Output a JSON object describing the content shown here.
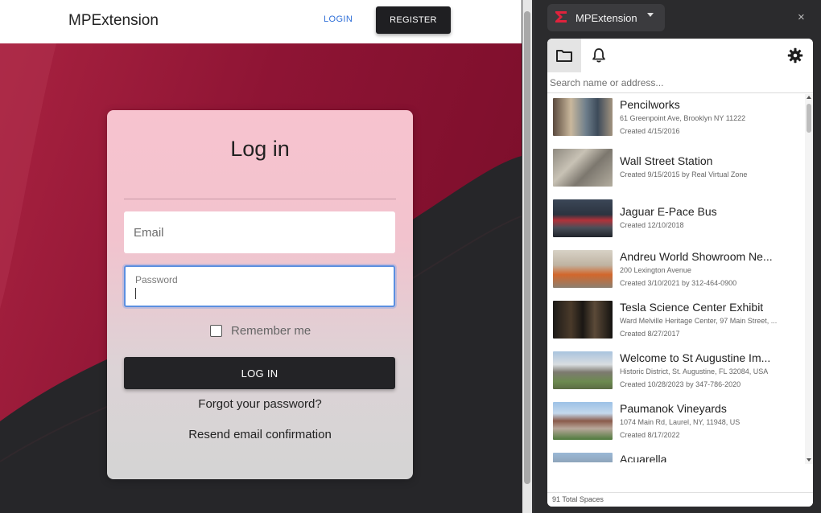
{
  "site": {
    "brand": "MPExtension",
    "nav_login": "LOGIN",
    "nav_register": "REGISTER"
  },
  "login_card": {
    "title": "Log in",
    "email_label": "Email",
    "password_label": "Password",
    "remember_label": "Remember me",
    "remember_checked": false,
    "submit_label": "LOG IN",
    "forgot_label": "Forgot your password?",
    "resend_label": "Resend email confirmation"
  },
  "extension": {
    "name": "MPExtension",
    "close_symbol": "×",
    "search_placeholder": "Search name or address...",
    "footer_text": "91 Total Spaces",
    "colors": {
      "brand": "#e0223c",
      "hero_crimson": "#9b1b3c",
      "hero_dark": "#262629"
    },
    "spaces": [
      {
        "title": "Pencilworks",
        "line1": "61 Greenpoint Ave, Brooklyn NY 11222",
        "line2": "Created 4/15/2016"
      },
      {
        "title": "Wall Street Station",
        "line1": "Created 9/15/2015 by Real Virtual Zone",
        "line2": ""
      },
      {
        "title": "Jaguar E-Pace Bus",
        "line1": "Created 12/10/2018",
        "line2": ""
      },
      {
        "title": "Andreu World Showroom Ne...",
        "line1": "200 Lexington Avenue",
        "line2": "Created 3/10/2021 by 312-464-0900"
      },
      {
        "title": "Tesla Science Center Exhibit",
        "line1": "Ward Melville Heritage Center, 97 Main Street, ...",
        "line2": "Created 8/27/2017"
      },
      {
        "title": "Welcome to St Augustine Im...",
        "line1": "Historic District, St. Augustine, FL 32084, USA",
        "line2": "Created 10/28/2023 by 347-786-2020"
      },
      {
        "title": "Paumanok Vineyards",
        "line1": "1074 Main Rd, Laurel, NY, 11948, US",
        "line2": "Created 8/17/2022"
      },
      {
        "title": "Acuarella",
        "line1": "",
        "line2": ""
      }
    ]
  }
}
